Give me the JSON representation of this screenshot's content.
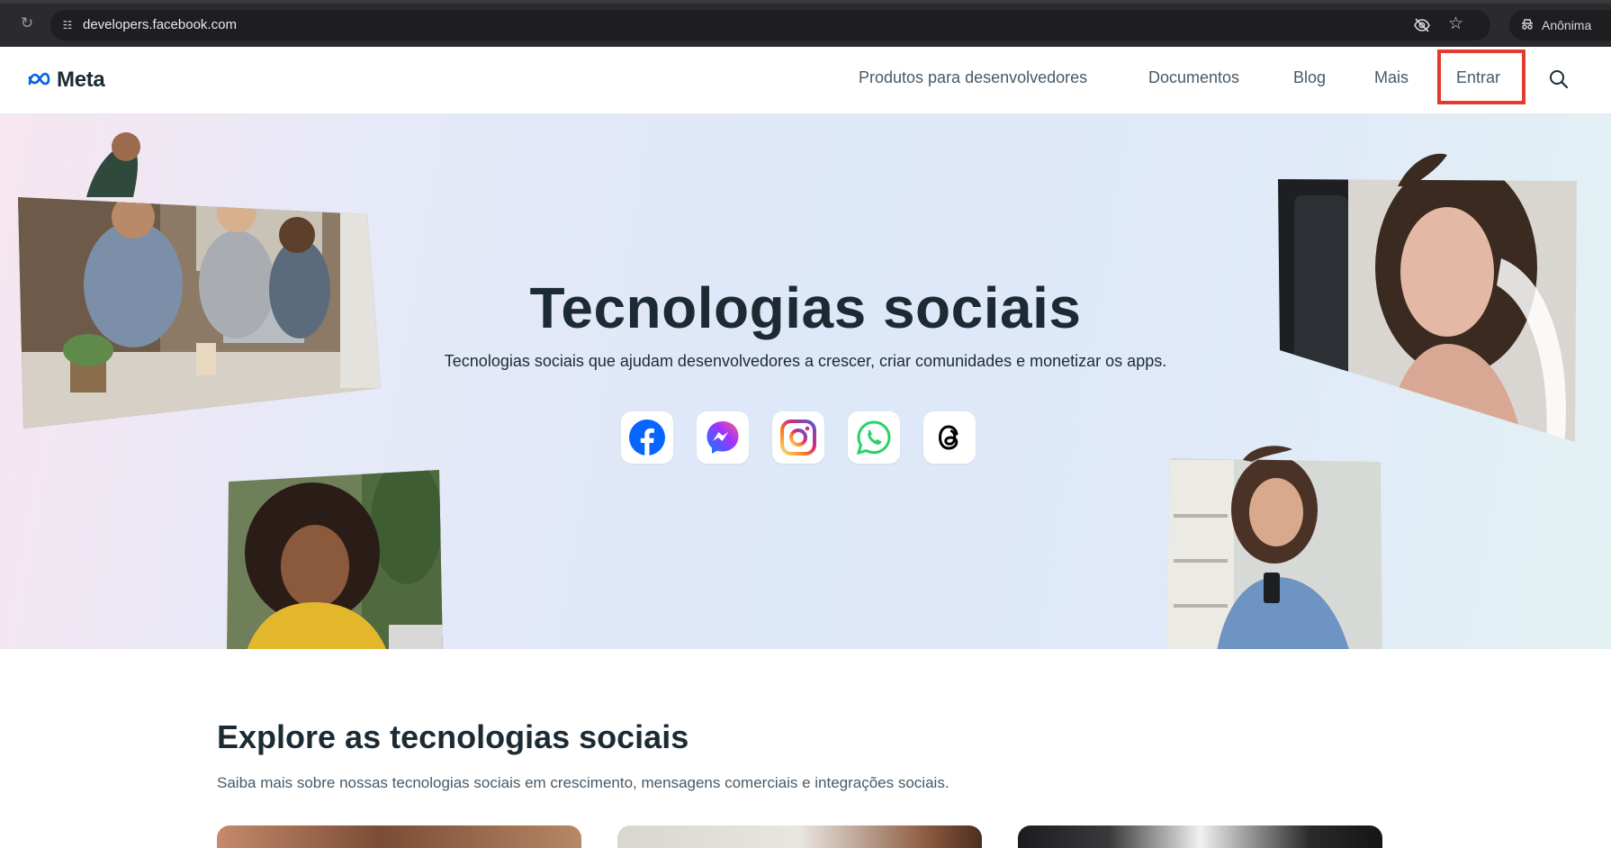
{
  "browser": {
    "url": "developers.facebook.com",
    "profile_label": "Anônima",
    "icons": [
      "reload-icon",
      "site-info-icon",
      "eye-off-icon",
      "bookmark-star-icon",
      "incognito-icon"
    ]
  },
  "header": {
    "logo_text": "Meta",
    "nav": {
      "products": "Produtos para desenvolvedores",
      "docs": "Documentos",
      "blog": "Blog",
      "more": "Mais",
      "login": "Entrar"
    }
  },
  "hero": {
    "title": "Tecnologias sociais",
    "subtitle": "Tecnologias sociais que ajudam desenvolvedores a crescer, criar comunidades e monetizar os apps.",
    "apps": [
      "facebook-icon",
      "messenger-icon",
      "instagram-icon",
      "whatsapp-icon",
      "threads-icon"
    ]
  },
  "explore": {
    "title": "Explore as tecnologias sociais",
    "subtitle": "Saiba mais sobre nossas tecnologias sociais em crescimento, mensagens comerciais e integrações sociais."
  },
  "colors": {
    "accent": "#0064e0",
    "highlight_box": "#e53a2f",
    "text_dark": "#1c2b33",
    "text_muted": "#465a69"
  }
}
